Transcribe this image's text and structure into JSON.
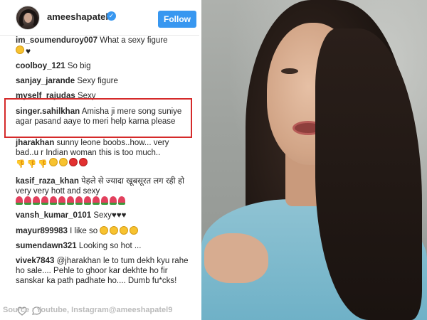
{
  "header": {
    "username": "ameeshapatel9",
    "verified_icon": "verified-badge-icon",
    "follow_label": "Follow"
  },
  "comments": [
    {
      "user": "im_soumenduroy007",
      "text": "What a sexy figure",
      "emoji": [
        "laugh",
        "heart"
      ]
    },
    {
      "user": "coolboy_121",
      "text": "So big"
    },
    {
      "user": "sanjay_jarande",
      "text": "Sexy figure"
    },
    {
      "user": "myself_rajudas",
      "text": "Sexy"
    },
    {
      "user": "singer.sahilkhan",
      "text": "Amisha ji mere song suniye agar pasand aaye to meri help karna please"
    },
    {
      "user": "jharakhan",
      "text": "sunny leone boobs..how... very bad..u r Indian woman this is too much..",
      "emoji": [
        "thumbdown",
        "thumbdown",
        "thumbdown",
        "laugh",
        "laugh",
        "angry",
        "angry"
      ]
    },
    {
      "user": "kasif_raza_khan",
      "text": "पेहले से ज्यादा खूबसूरत लग रही हो very very hott and sexy",
      "emoji": [
        "tulip",
        "tulip",
        "tulip",
        "tulip",
        "tulip",
        "tulip",
        "tulip",
        "tulip",
        "tulip",
        "tulip",
        "tulip",
        "tulip",
        "tulip"
      ]
    },
    {
      "user": "vansh_kumar_0101",
      "text": "Sexy♥♥♥"
    },
    {
      "user": "mayur899983",
      "text": "I like so",
      "emoji": [
        "laugh",
        "laugh",
        "laugh",
        "laugh"
      ]
    },
    {
      "user": "sumendawn321",
      "text": "Looking so hot ..."
    },
    {
      "user": "vivek7843",
      "text": "@jharakhan le to tum dekh kyu rahe ho sale.... Pehle to ghoor kar dekhte ho fir sanskar ka path padhate ho.... Dumb fu*cks!"
    }
  ],
  "footer": {
    "source": "Source : Youtube, Instagram@ameeshapatel9"
  }
}
